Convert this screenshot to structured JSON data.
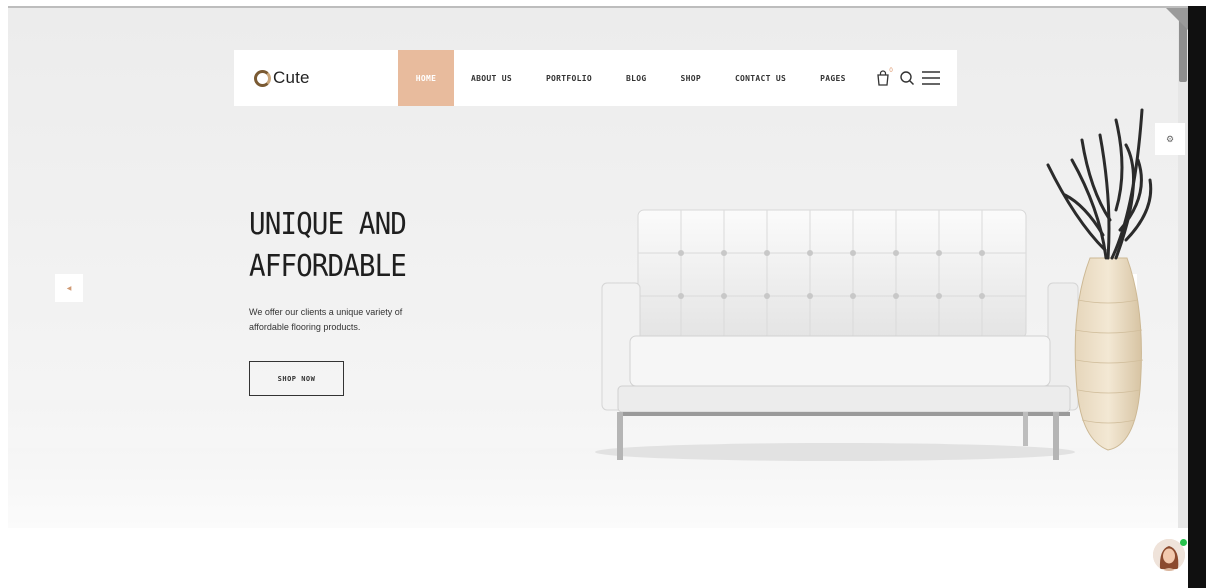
{
  "header": {
    "logo_text": "Cute",
    "nav": [
      {
        "label": "HOME",
        "active": true
      },
      {
        "label": "ABOUT US"
      },
      {
        "label": "PORTFOLIO"
      },
      {
        "label": "BLOG"
      },
      {
        "label": "SHOP"
      },
      {
        "label": "CONTACT US"
      },
      {
        "label": "PAGES"
      }
    ],
    "cart_count": "0",
    "icons": [
      "cart-icon",
      "search-icon",
      "menu-icon"
    ]
  },
  "hero": {
    "title_line1": "UNIQUE AND",
    "title_line2": "AFFORDABLE",
    "subtitle_line1": "We offer our clients a unique variety of",
    "subtitle_line2": "affordable flooring products.",
    "button_label": "SHOP NOW"
  },
  "slider": {
    "prev_icon": "chevron-left-icon",
    "next_icon": "chevron-right-icon"
  },
  "colors": {
    "accent": "#e8bb9d",
    "text": "#1f1f1f",
    "background": "#f1f1f1"
  }
}
